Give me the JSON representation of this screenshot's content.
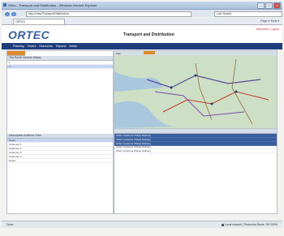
{
  "window": {
    "title": "Ortec - Transport and Distribution - Windows Internet Explorer"
  },
  "browser": {
    "address": "http://ortec/TransportDistribution",
    "tab_label": "ORTEC",
    "toolbar_tools": "Page ▾  Tools ▾",
    "search_placeholder": "Live Search"
  },
  "app": {
    "logo": "ORTEC",
    "title": "Transport and Distribution",
    "user_links": "Welcome  |  Logout"
  },
  "menu": [
    "Planning",
    "Orders",
    "Resources",
    "Reports",
    "Admin"
  ],
  "left_panel": {
    "header": "Trip  Route  Vehicle  Status",
    "rows": [
      "1",
      "2"
    ],
    "lower_header": "Description  Address  Time",
    "lower_rows": [
      "Depot",
      "Customer 1",
      "Customer 2",
      "Customer 3",
      "Customer 4",
      "Depot"
    ]
  },
  "map": {
    "tab": "Map"
  },
  "right_panel": {
    "rows_selected": [
      "Order  Customer  Pickup  Delivery",
      "Order  Customer  Pickup  Delivery",
      "Order  Customer  Pickup  Delivery"
    ],
    "rows": [
      "Order  Customer  Pickup  Delivery",
      "Order  Customer  Pickup  Delivery"
    ]
  },
  "status": {
    "left": "Done",
    "right": "Local intranet | Protected Mode: Off    100%"
  },
  "colors": {
    "brand": "#3a5f9e",
    "menu": "#1f3d7a",
    "accent": "#e08a2c",
    "map_land": "#cde0c6"
  }
}
